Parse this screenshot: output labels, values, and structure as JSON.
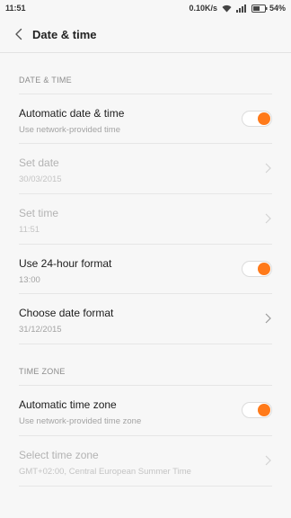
{
  "status_bar": {
    "time": "11:51",
    "network_speed": "0.10K/s",
    "battery": "54%"
  },
  "header": {
    "title": "Date & time"
  },
  "sections": {
    "date_time": {
      "header": "DATE & TIME",
      "items": [
        {
          "label": "Automatic date & time",
          "sub": "Use network-provided time",
          "control": "toggle",
          "enabled": true,
          "on": true
        },
        {
          "label": "Set date",
          "sub": "30/03/2015",
          "control": "chevron",
          "enabled": false
        },
        {
          "label": "Set time",
          "sub": "11:51",
          "control": "chevron",
          "enabled": false
        },
        {
          "label": "Use 24-hour format",
          "sub": "13:00",
          "control": "toggle",
          "enabled": true,
          "on": true
        },
        {
          "label": "Choose date format",
          "sub": "31/12/2015",
          "control": "chevron",
          "enabled": true
        }
      ]
    },
    "time_zone": {
      "header": "TIME ZONE",
      "items": [
        {
          "label": "Automatic time zone",
          "sub": "Use network-provided time zone",
          "control": "toggle",
          "enabled": true,
          "on": true
        },
        {
          "label": "Select time zone",
          "sub": "GMT+02:00, Central European Summer Time",
          "control": "chevron",
          "enabled": false
        }
      ]
    }
  },
  "colors": {
    "accent": "#ff7a1a",
    "background": "#f7f7f7"
  }
}
